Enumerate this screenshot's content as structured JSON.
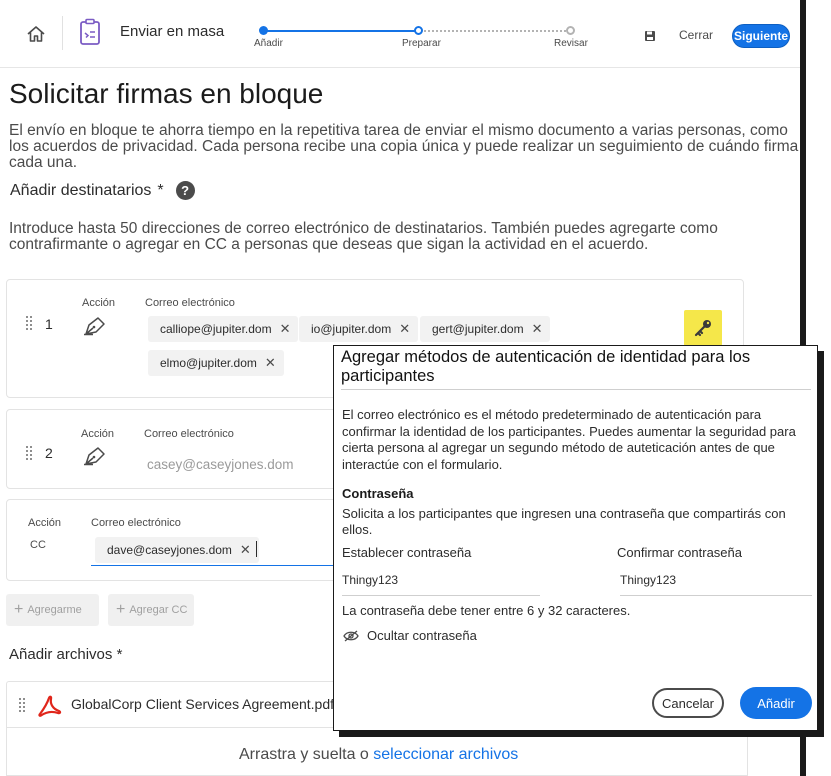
{
  "header": {
    "title": "Enviar en masa",
    "steps": [
      "Añadir",
      "Preparar",
      "Revisar"
    ],
    "close_label": "Cerrar",
    "next_label": "Siguiente",
    "accent_color": "#1473e6"
  },
  "main": {
    "title": "Solicitar firmas en bloque",
    "intro": "El envío en bloque te ahorra tiempo en la repetitiva tarea de enviar el mismo documento a varias personas, como los acuerdos de privacidad. Cada persona recibe una copia única y puede realizar un seguimiento de cuándo firma cada una.",
    "recipients_heading": "Añadir destinatarios",
    "required_mark": "*",
    "help_glyph": "?",
    "recipients_intro": "Introduce hasta 50 direcciones de correo electrónico de destinatarios. También puedes agregarte como contrafirmante o agregar en CC a personas que deseas que sigan la actividad en el acuerdo."
  },
  "recipients": [
    {
      "number": "1",
      "action_label": "Acción",
      "email_label": "Correo electrónico",
      "emails": [
        "calliope@jupiter.dom",
        "io@jupiter.dom",
        "gert@jupiter.dom",
        "elmo@jupiter.dom"
      ]
    },
    {
      "number": "2",
      "action_label": "Acción",
      "email_label": "Correo electrónico",
      "placeholder": "casey@caseyjones.dom"
    }
  ],
  "cc": {
    "action_label": "Acción",
    "action_value": "CC",
    "email_label": "Correo electrónico",
    "emails": [
      "dave@caseyjones.dom"
    ]
  },
  "actions": {
    "add_me": "Agregarme",
    "add_cc": "Agregar CC"
  },
  "files": {
    "heading": "Añadir archivos",
    "required_mark": "*",
    "file_name": "GlobalCorp Client Services Agreement.pdf",
    "drop_text": "Arrastra y suelta o",
    "drop_link": "seleccionar archivos"
  },
  "modal": {
    "title": "Agregar métodos de autenticación de identidad para los participantes",
    "description": "El correo electrónico es el método predeterminado de autenticación para confirmar la identidad de los participantes. Puedes aumentar la seguridad para cierta persona al agregar un segundo método de auteticación antes de que interactúe con el formulario.",
    "password_heading": "Contraseña",
    "password_description": "Solicita a los participantes que ingresen una contraseña que compartirás con ellos.",
    "set_password_label": "Establecer contraseña",
    "set_password_value": "Thingy123",
    "confirm_password_label": "Confirmar contraseña",
    "confirm_password_value": "Thingy123",
    "password_rule": "La contraseña debe tener entre 6 y 32 caracteres.",
    "toggle_label": "Ocultar contraseña",
    "cancel_label": "Cancelar",
    "add_label": "Añadir"
  }
}
